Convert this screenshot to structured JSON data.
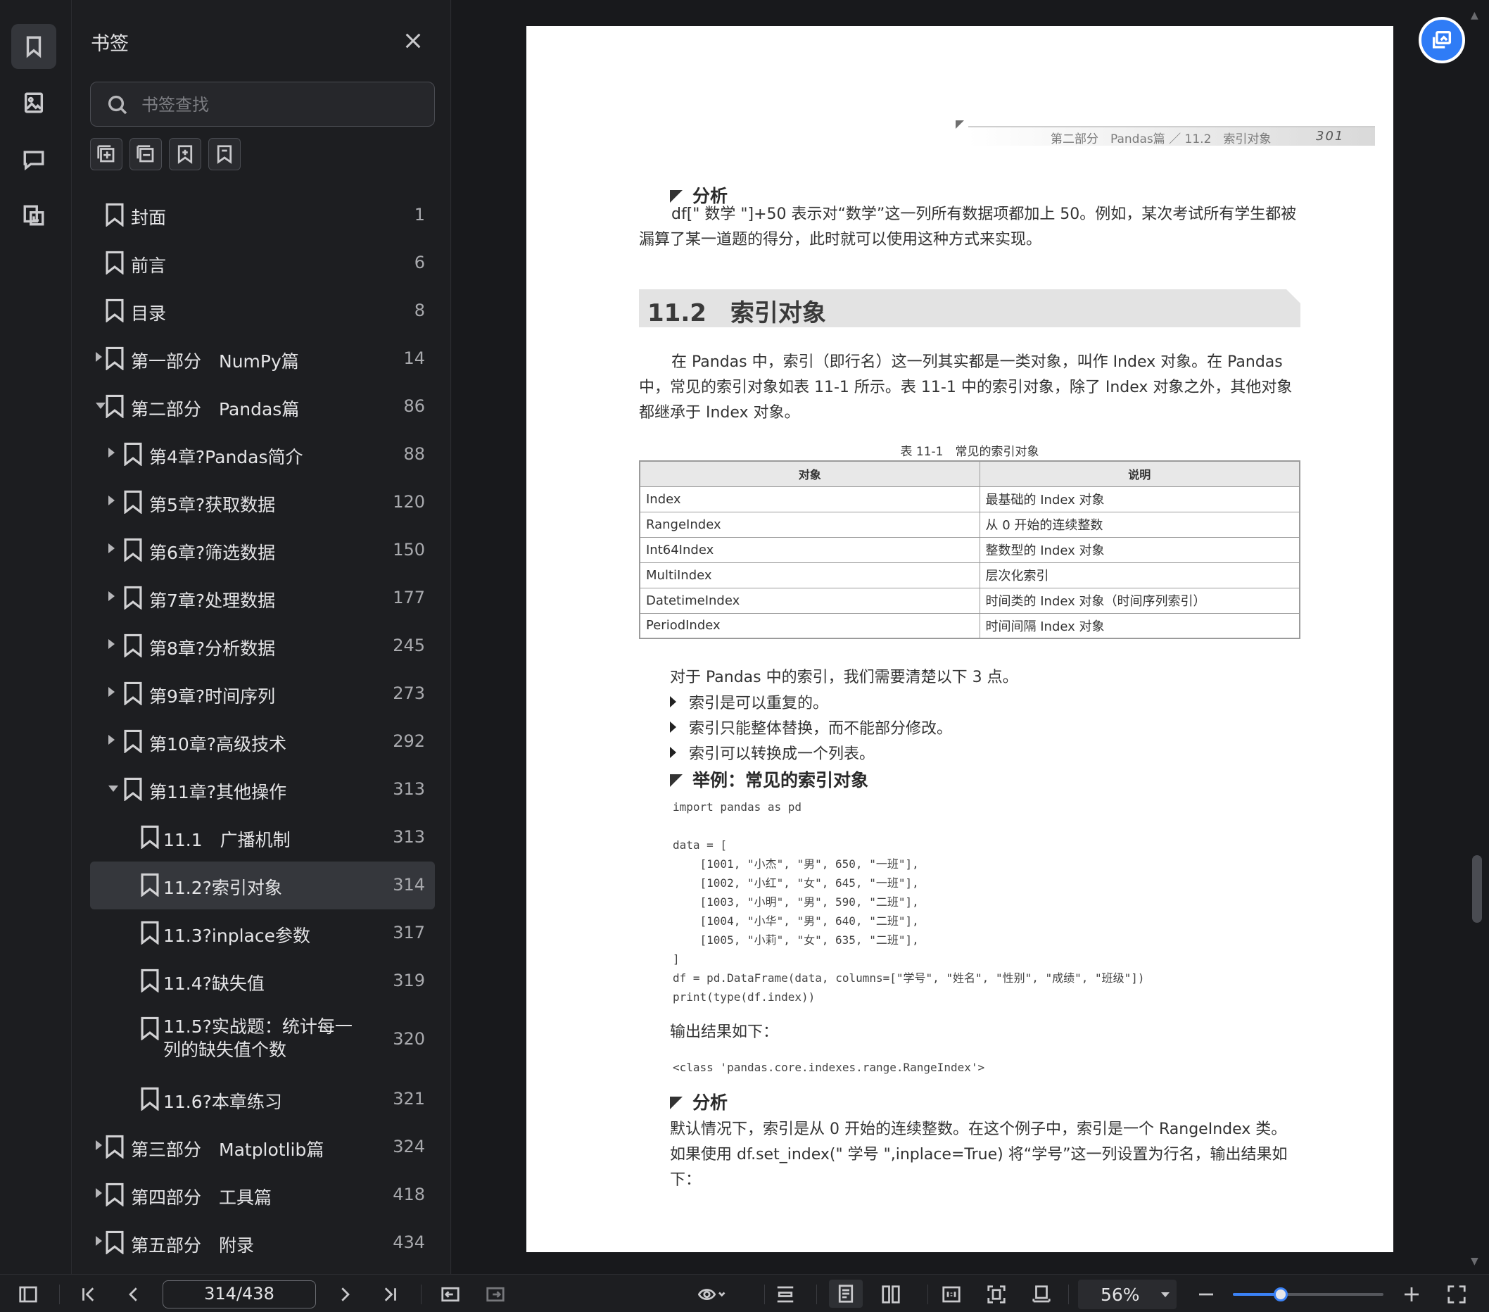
{
  "panel": {
    "title": "书签",
    "search_placeholder": "书签查找"
  },
  "bookmarks": [
    {
      "label": "封面",
      "page": "1",
      "level": 0,
      "expand": "none"
    },
    {
      "label": "前言",
      "page": "6",
      "level": 0,
      "expand": "none"
    },
    {
      "label": "目录",
      "page": "8",
      "level": 0,
      "expand": "none"
    },
    {
      "label": "第一部分　NumPy篇",
      "page": "14",
      "level": 0,
      "expand": "collapsed"
    },
    {
      "label": "第二部分　Pandas篇",
      "page": "86",
      "level": 0,
      "expand": "expanded"
    },
    {
      "label": "第4章?Pandas简介",
      "page": "88",
      "level": 1,
      "expand": "collapsed"
    },
    {
      "label": "第5章?获取数据",
      "page": "120",
      "level": 1,
      "expand": "collapsed"
    },
    {
      "label": "第6章?筛选数据",
      "page": "150",
      "level": 1,
      "expand": "collapsed"
    },
    {
      "label": "第7章?处理数据",
      "page": "177",
      "level": 1,
      "expand": "collapsed"
    },
    {
      "label": "第8章?分析数据",
      "page": "245",
      "level": 1,
      "expand": "collapsed"
    },
    {
      "label": "第9章?时间序列",
      "page": "273",
      "level": 1,
      "expand": "collapsed"
    },
    {
      "label": "第10章?高级技术",
      "page": "292",
      "level": 1,
      "expand": "collapsed"
    },
    {
      "label": "第11章?其他操作",
      "page": "313",
      "level": 1,
      "expand": "expanded"
    },
    {
      "label": "11.1　广播机制",
      "page": "313",
      "level": 2,
      "expand": "none"
    },
    {
      "label": "11.2?索引对象",
      "page": "314",
      "level": 2,
      "expand": "none",
      "selected": true
    },
    {
      "label": "11.3?inplace参数",
      "page": "317",
      "level": 2,
      "expand": "none"
    },
    {
      "label": "11.4?缺失值",
      "page": "319",
      "level": 2,
      "expand": "none"
    },
    {
      "label": "11.5?实战题：统计每一列的缺失值个数",
      "page": "320",
      "level": 2,
      "expand": "none",
      "tall": true
    },
    {
      "label": "11.6?本章练习",
      "page": "321",
      "level": 2,
      "expand": "none"
    },
    {
      "label": "第三部分　Matplotlib篇",
      "page": "324",
      "level": 0,
      "expand": "collapsed"
    },
    {
      "label": "第四部分　工具篇",
      "page": "418",
      "level": 0,
      "expand": "collapsed"
    },
    {
      "label": "第五部分　附录",
      "page": "434",
      "level": 0,
      "expand": "collapsed"
    }
  ],
  "document": {
    "running_head": "第二部分　Pandas篇 ／ 11.2　索引对象",
    "page_number": "301",
    "analysis_heading": "分析",
    "para1": "df[\" 数学 \"]+50 表示对“数学”这一列所有数据项都加上 50。例如，某次考试所有学生都被漏算了某一道题的得分，此时就可以使用这种方式来实现。",
    "section_title": "11.2　索引对象",
    "para2": "在 Pandas 中，索引（即行名）这一列其实都是一类对象，叫作 Index 对象。在 Pandas 中，常见的索引对象如表 11-1 所示。表 11-1 中的索引对象，除了 Index 对象之外，其他对象都继承于 Index 对象。",
    "table_caption": "表 11-1　常见的索引对象",
    "table_headers": [
      "对象",
      "说明"
    ],
    "table_rows": [
      [
        "Index",
        "最基础的 Index 对象"
      ],
      [
        "RangeIndex",
        "从 0 开始的连续整数"
      ],
      [
        "Int64Index",
        "整数型的 Index 对象"
      ],
      [
        "MultiIndex",
        "层次化索引"
      ],
      [
        "DatetimeIndex",
        "时间类的 Index 对象（时间序列索引）"
      ],
      [
        "PeriodIndex",
        "时间间隔 Index 对象"
      ]
    ],
    "points_intro": "对于 Pandas 中的索引，我们需要清楚以下 3 点。",
    "points": [
      "索引是可以重复的。",
      "索引只能整体替换，而不能部分修改。",
      "索引可以转换成一个列表。"
    ],
    "example_heading": "举例：常见的索引对象",
    "code1": "import pandas as pd",
    "code2": "data = [\n    [1001, \"小杰\", \"男\", 650, \"一班\"],\n    [1002, \"小红\", \"女\", 645, \"一班\"],\n    [1003, \"小明\", \"男\", 590, \"二班\"],\n    [1004, \"小华\", \"男\", 640, \"二班\"],\n    [1005, \"小莉\", \"女\", 635, \"二班\"],\n]\ndf = pd.DataFrame(data, columns=[\"学号\", \"姓名\", \"性别\", \"成绩\", \"班级\"])\nprint(type(df.index))",
    "output_label": "输出结果如下：",
    "code_output": "<class 'pandas.core.indexes.range.RangeIndex'>",
    "analysis2_heading": "分析",
    "para3": "默认情况下，索引是从 0 开始的连续整数。在这个例子中，索引是一个 RangeIndex 类。",
    "para4": "如果使用 df.set_index(\" 学号 \",inplace=True) 将“学号”这一列设置为行名，输出结果如下："
  },
  "toolbar": {
    "page_indicator": "314/438",
    "zoom": "56%",
    "zoom_fraction": 0.32
  },
  "colors": {
    "accent": "#3b82f6",
    "fab": "#2f7cf6",
    "selected_row": "#35373c"
  }
}
